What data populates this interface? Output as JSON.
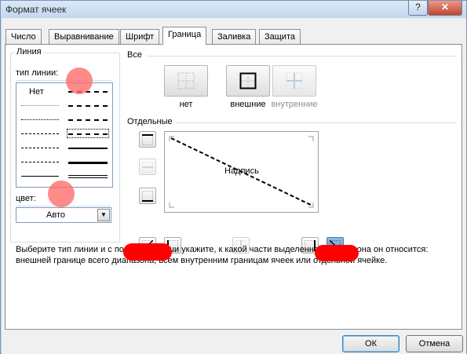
{
  "window": {
    "title": "Формат ячеек",
    "help_label": "?",
    "close_label": "✕"
  },
  "tabs": [
    {
      "label": "Число"
    },
    {
      "label": "Выравнивание"
    },
    {
      "label": "Шрифт"
    },
    {
      "label": "Граница",
      "active": true
    },
    {
      "label": "Заливка"
    },
    {
      "label": "Защита"
    }
  ],
  "line_group": {
    "title": "Линия",
    "style_label": "тип линии:",
    "none_label": "Нет",
    "styles_left": [
      "none",
      "hair",
      "dotted",
      "dash-dot-dot",
      "dash-dot",
      "dashed",
      "thin"
    ],
    "styles_right": [
      "medium-dash-dot-dot",
      "slanted-dash-dot",
      "medium-dash-dot",
      "medium-dashed",
      "medium",
      "thick",
      "double"
    ],
    "selected_style": "dashed",
    "color_label": "цвет:",
    "color_value": "Авто",
    "color_dropdown_icon": "chevron-down-icon"
  },
  "presets": {
    "title": "Все",
    "items": [
      {
        "label": "нет",
        "icon": "border-none-icon",
        "enabled": true
      },
      {
        "label": "внешние",
        "icon": "border-outline-icon",
        "enabled": true
      },
      {
        "label": "внутренние",
        "icon": "border-inside-icon",
        "enabled": false
      }
    ]
  },
  "border": {
    "title": "Отдельные",
    "preview_text": "Надпись",
    "left_buttons": [
      {
        "name": "border-top-button",
        "icon": "border-top-icon",
        "enabled": true
      },
      {
        "name": "border-horizontal-inside-button",
        "icon": "border-horizontal-inside-icon",
        "enabled": false
      },
      {
        "name": "border-bottom-button",
        "icon": "border-bottom-icon",
        "enabled": true
      }
    ],
    "bottom_buttons": [
      {
        "name": "border-diagonal-up-button",
        "icon": "diagonal-up-icon",
        "enabled": true,
        "pressed": false
      },
      {
        "name": "border-left-button",
        "icon": "border-left-icon",
        "enabled": true,
        "pressed": false
      },
      {
        "name": "border-vertical-inside-button",
        "icon": "border-vertical-inside-icon",
        "enabled": false,
        "pressed": false
      },
      {
        "name": "border-right-button",
        "icon": "border-right-icon",
        "enabled": true,
        "pressed": false
      },
      {
        "name": "border-diagonal-down-button",
        "icon": "diagonal-down-icon",
        "enabled": true,
        "pressed": true
      }
    ]
  },
  "description": {
    "line1": "Выберите тип линии и с помощью мыши укажите, к какой части выделенного диапазона он относится:",
    "line2": "внешней границе всего диапазона, всем внутренним границам ячеек или отдельной ячейке."
  },
  "buttons": {
    "ok": "ОК",
    "cancel": "Отмена"
  },
  "colors": {
    "accent": "#5d9dd6",
    "annotation_red": "#ff0000",
    "annotation_pink": "#ff6969"
  }
}
